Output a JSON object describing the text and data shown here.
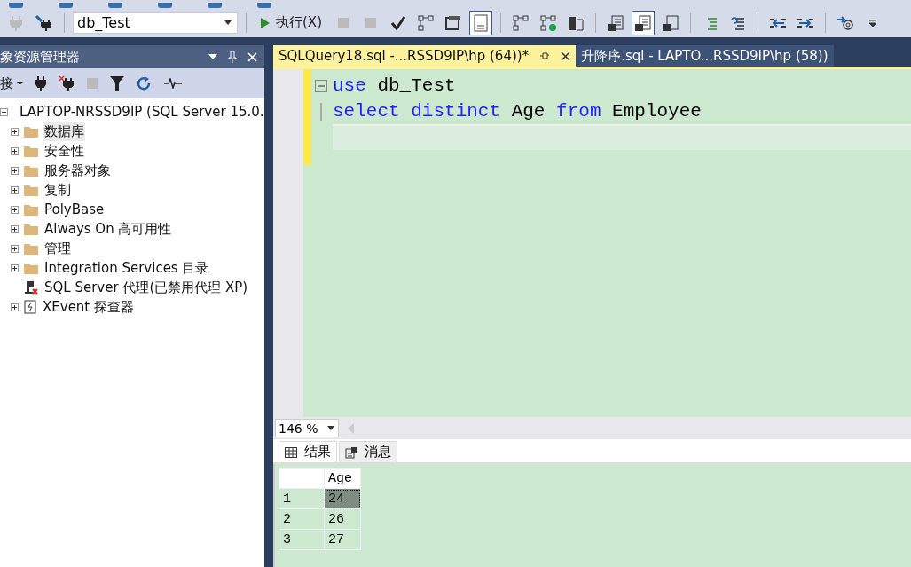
{
  "toolbar": {
    "database": "db_Test",
    "execute": "执行(X)",
    "buttons": [
      {
        "kind": "debug",
        "pressed": false
      },
      {
        "kind": "stop",
        "pressed": false
      },
      {
        "kind": "check",
        "pressed": false
      },
      {
        "kind": "plan",
        "pressed": false
      },
      {
        "kind": "window",
        "pressed": false
      },
      {
        "kind": "panel",
        "pressed": true
      },
      {
        "kind": "plan",
        "pressed": false
      },
      {
        "kind": "plancheck",
        "pressed": false
      },
      {
        "kind": "server",
        "pressed": false
      },
      {
        "kind": "text",
        "pressed": false
      },
      {
        "kind": "grid",
        "pressed": true
      },
      {
        "kind": "file",
        "pressed": false
      },
      {
        "kind": "comment",
        "pressed": false
      },
      {
        "kind": "uncomment",
        "pressed": false
      },
      {
        "kind": "outdent",
        "pressed": false
      },
      {
        "kind": "indent",
        "pressed": false
      },
      {
        "kind": "at",
        "pressed": false
      },
      {
        "kind": "more",
        "pressed": false
      }
    ]
  },
  "explorer": {
    "title": "象资源管理器",
    "connect": "接",
    "tree": [
      {
        "kind": "server",
        "label": "LAPTOP-NRSSD9IP (SQL Server 15.0.",
        "expanded": true,
        "selected": false,
        "children": [
          {
            "kind": "folder",
            "label": "数据库",
            "expanded": false,
            "selected": true
          },
          {
            "kind": "folder",
            "label": "安全性",
            "expanded": false,
            "selected": false
          },
          {
            "kind": "folder",
            "label": "服务器对象",
            "expanded": false,
            "selected": false
          },
          {
            "kind": "folder",
            "label": "复制",
            "expanded": false,
            "selected": false
          },
          {
            "kind": "folder",
            "label": "PolyBase",
            "expanded": false,
            "selected": false
          },
          {
            "kind": "folder",
            "label": "Always On 高可用性",
            "expanded": false,
            "selected": false
          },
          {
            "kind": "folder",
            "label": "管理",
            "expanded": false,
            "selected": false
          },
          {
            "kind": "folder",
            "label": "Integration Services 目录",
            "expanded": false,
            "selected": false
          },
          {
            "kind": "agent",
            "label": "SQL Server 代理(已禁用代理 XP)",
            "selected": false
          },
          {
            "kind": "xevent",
            "label": "XEvent 探查器",
            "expanded": false,
            "selected": false
          }
        ]
      }
    ]
  },
  "tabs": [
    {
      "label": "SQLQuery18.sql -...RSSD9IP\\hp (64))*",
      "selected": true
    },
    {
      "label": "升降序.sql - LAPTO...RSSD9IP\\hp (58))",
      "selected": false
    }
  ],
  "editor": {
    "lines": [
      [
        {
          "t": "use",
          "kw": true
        },
        {
          "t": " db_Test",
          "kw": false
        }
      ],
      [
        {
          "t": "select",
          "kw": true
        },
        {
          "t": " distinct",
          "kw": true
        },
        {
          "t": " Age",
          "kw": false
        },
        {
          "t": " from",
          "kw": true
        },
        {
          "t": " Employee",
          "kw": false
        }
      ]
    ]
  },
  "zoom": "146 %",
  "result_tabs": [
    {
      "kind": "grid",
      "label": "结果",
      "selected": true
    },
    {
      "kind": "messages",
      "label": "消息",
      "selected": false
    }
  ],
  "results": {
    "columns": [
      "Age"
    ],
    "rows": [
      {
        "num": "1",
        "cells": [
          "24"
        ],
        "selected": true
      },
      {
        "num": "2",
        "cells": [
          "26"
        ],
        "selected": false
      },
      {
        "num": "3",
        "cells": [
          "27"
        ],
        "selected": false
      }
    ]
  }
}
